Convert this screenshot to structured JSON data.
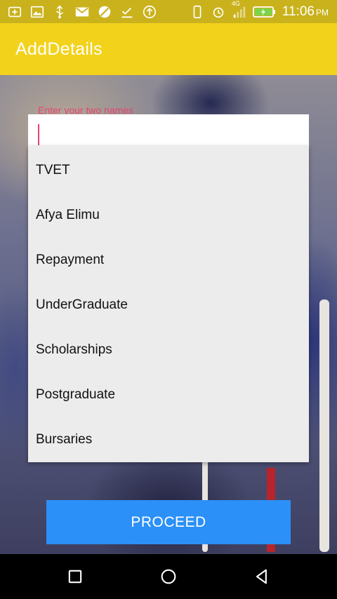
{
  "status_bar": {
    "time": "11:06",
    "ampm": "PM",
    "network": "4G",
    "icons": [
      "add-box-icon",
      "image-icon",
      "usb-icon",
      "gmail-icon",
      "block-icon",
      "download-done-icon",
      "upload-icon",
      "phone-icon",
      "alarm-icon",
      "signal-icon",
      "battery-charging-icon"
    ]
  },
  "app_bar": {
    "title": "AddDetails"
  },
  "name_input": {
    "label": "Enter your two names",
    "value": ""
  },
  "dropdown": {
    "options": [
      "TVET",
      "Afya Elimu",
      "Repayment",
      "UnderGraduate",
      "Scholarships",
      "Postgraduate",
      "Bursaries"
    ]
  },
  "proceed_button": {
    "label": "PROCEED"
  },
  "nav_bar": {
    "buttons": [
      "recents-square-icon",
      "home-circle-icon",
      "back-triangle-icon"
    ]
  },
  "colors": {
    "app_bar": "#f3d21c",
    "accent": "#e9426f",
    "button": "#2b90f7"
  }
}
